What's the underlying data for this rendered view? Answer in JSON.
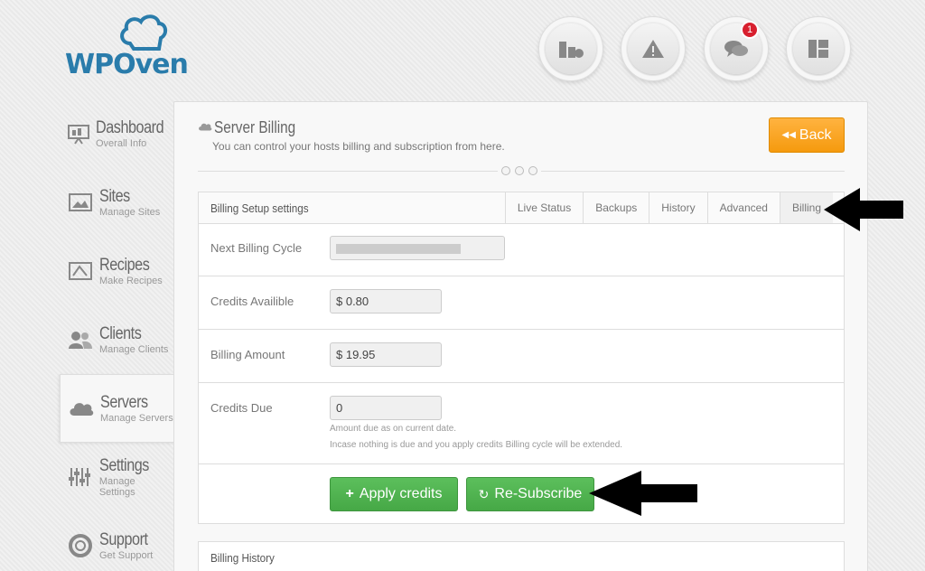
{
  "brand": {
    "name": "WPOven",
    "color": "#2a7cab"
  },
  "top_icons": [
    {
      "name": "credits-icon"
    },
    {
      "name": "alert-icon"
    },
    {
      "name": "messages-icon",
      "badge": "1"
    },
    {
      "name": "layout-icon"
    }
  ],
  "sidebar": {
    "items": [
      {
        "title": "Dashboard",
        "subtitle": "Overall Info",
        "icon": "dashboard-icon"
      },
      {
        "title": "Sites",
        "subtitle": "Manage Sites",
        "icon": "sites-icon"
      },
      {
        "title": "Recipes",
        "subtitle": "Make Recipes",
        "icon": "recipes-icon"
      },
      {
        "title": "Clients",
        "subtitle": "Manage Clients",
        "icon": "clients-icon"
      },
      {
        "title": "Servers",
        "subtitle": "Manage Servers",
        "icon": "cloud-icon",
        "active": true
      },
      {
        "title": "Settings",
        "subtitle": "Manage Settings",
        "icon": "settings-icon"
      },
      {
        "title": "Support",
        "subtitle": "Get Support",
        "icon": "support-icon"
      }
    ]
  },
  "main": {
    "title": "Server Billing",
    "subtitle": "You can control your hosts billing and subscription from here.",
    "back_label": "Back",
    "card_title": "Billing Setup settings",
    "tabs": [
      "Live Status",
      "Backups",
      "History",
      "Advanced",
      "Billing"
    ],
    "active_tab": "Billing",
    "fields": {
      "next_billing_label": "Next Billing Cycle",
      "credits_label": "Credits Availible",
      "credits_value": "$ 0.80",
      "amount_label": "Billing Amount",
      "amount_value": "$ 19.95",
      "due_label": "Credits Due",
      "due_value": "0",
      "due_help_1": "Amount due as on current date.",
      "due_help_2": "Incase nothing is due and you apply credits Billing cycle will be extended."
    },
    "apply_label": "Apply credits",
    "resubscribe_label": "Re-Subscribe",
    "history_title": "Billing History"
  },
  "colors": {
    "accent_orange": "#f59a0e",
    "green": "#46a846",
    "badge_red": "#d8202f"
  }
}
